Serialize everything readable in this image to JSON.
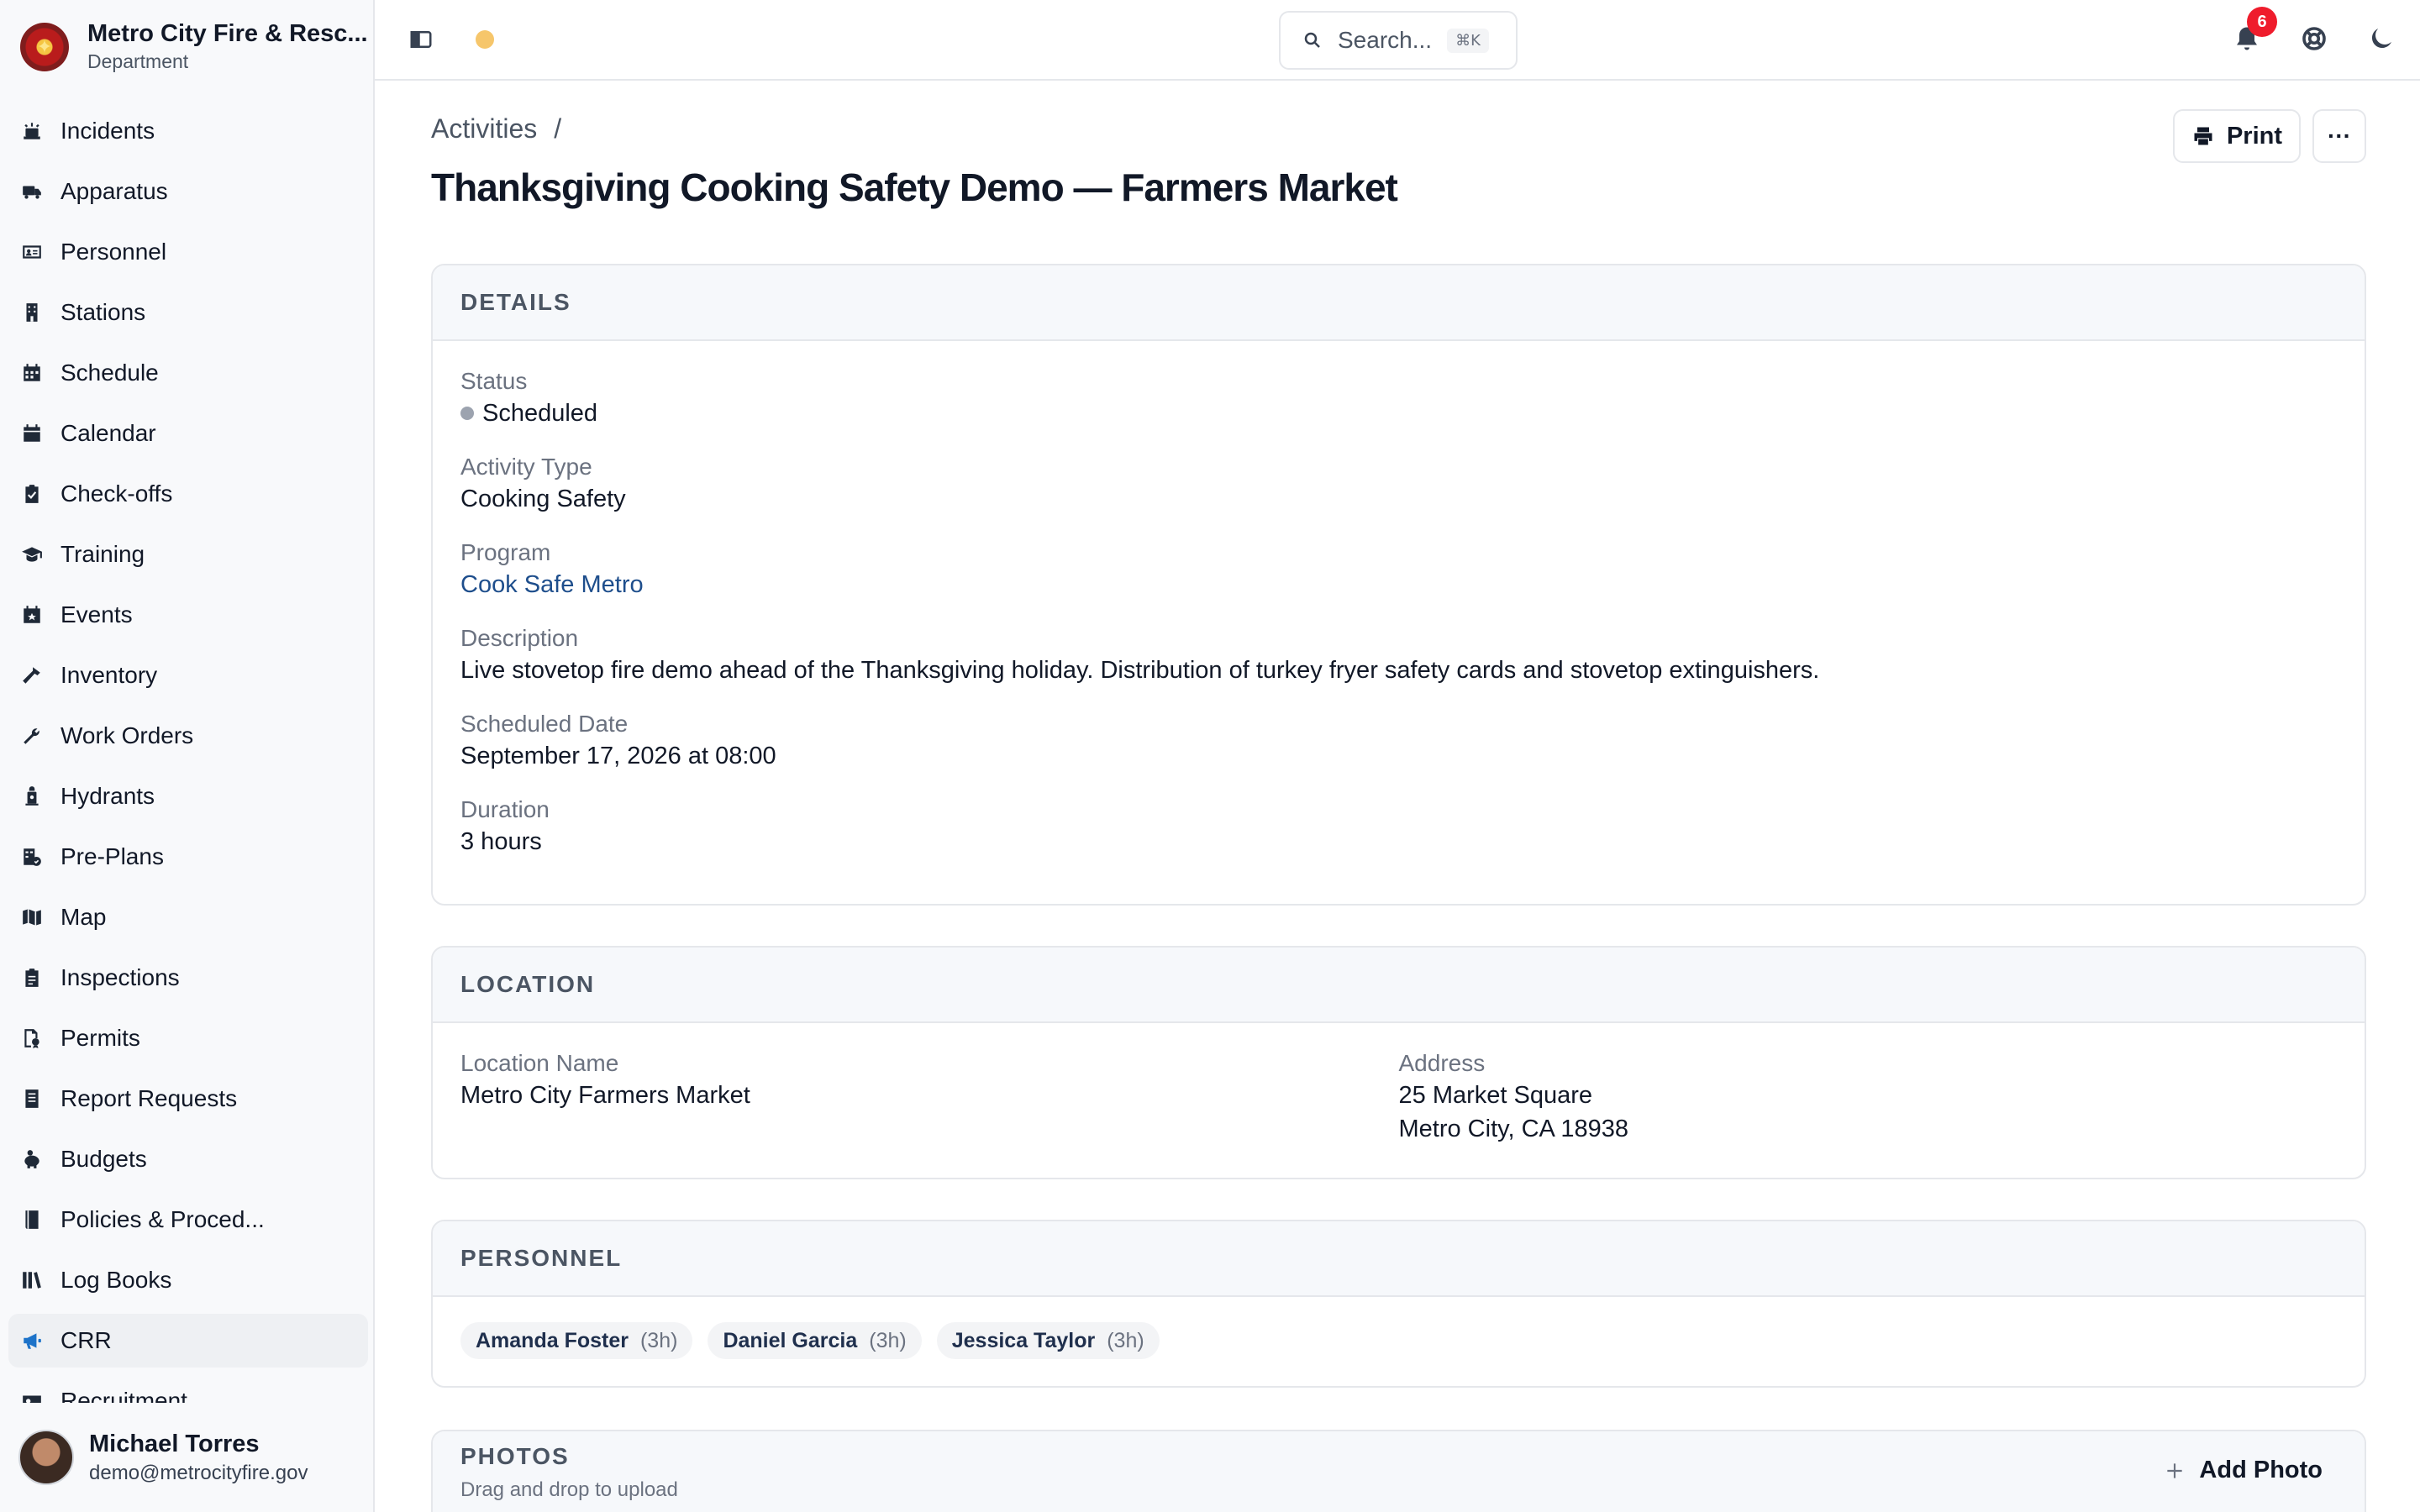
{
  "org": {
    "name": "Metro City Fire & Resc...",
    "subtitle": "Department"
  },
  "sidebar": {
    "items": [
      {
        "label": "Incidents",
        "icon": "incident-icon"
      },
      {
        "label": "Apparatus",
        "icon": "truck-icon"
      },
      {
        "label": "Personnel",
        "icon": "id-card-icon"
      },
      {
        "label": "Stations",
        "icon": "building-icon"
      },
      {
        "label": "Schedule",
        "icon": "calendar-grid-icon"
      },
      {
        "label": "Calendar",
        "icon": "calendar-icon"
      },
      {
        "label": "Check-offs",
        "icon": "clipboard-check-icon"
      },
      {
        "label": "Training",
        "icon": "graduation-cap-icon"
      },
      {
        "label": "Events",
        "icon": "calendar-star-icon"
      },
      {
        "label": "Inventory",
        "icon": "hammer-icon"
      },
      {
        "label": "Work Orders",
        "icon": "wrench-icon"
      },
      {
        "label": "Hydrants",
        "icon": "hydrant-icon"
      },
      {
        "label": "Pre-Plans",
        "icon": "plan-icon"
      },
      {
        "label": "Map",
        "icon": "map-icon"
      },
      {
        "label": "Inspections",
        "icon": "clipboard-icon"
      },
      {
        "label": "Permits",
        "icon": "permit-icon"
      },
      {
        "label": "Report Requests",
        "icon": "report-icon"
      },
      {
        "label": "Budgets",
        "icon": "piggy-bank-icon"
      },
      {
        "label": "Policies & Proced...",
        "icon": "book-icon"
      },
      {
        "label": "Log Books",
        "icon": "books-icon"
      },
      {
        "label": "CRR",
        "icon": "megaphone-icon",
        "active": true
      },
      {
        "label": "Recruitment",
        "icon": "recruit-icon"
      }
    ]
  },
  "user": {
    "name": "Michael Torres",
    "email": "demo@metrocityfire.gov"
  },
  "topbar": {
    "search_placeholder": "Search...",
    "search_shortcut": "⌘K",
    "notification_count": "6"
  },
  "breadcrumb": {
    "parent": "Activities",
    "separator": "/"
  },
  "page": {
    "title": "Thanksgiving Cooking Safety Demo — Farmers Market",
    "print_label": "Print",
    "more_label": "···"
  },
  "details": {
    "heading": "DETAILS",
    "status_label": "Status",
    "status_value": "Scheduled",
    "type_label": "Activity Type",
    "type_value": "Cooking Safety",
    "program_label": "Program",
    "program_value": "Cook Safe Metro",
    "description_label": "Description",
    "description_value": "Live stovetop fire demo ahead of the Thanksgiving holiday. Distribution of turkey fryer safety cards and stovetop extinguishers.",
    "date_label": "Scheduled Date",
    "date_value": "September 17, 2026 at 08:00",
    "duration_label": "Duration",
    "duration_value": "3 hours"
  },
  "location": {
    "heading": "LOCATION",
    "name_label": "Location Name",
    "name_value": "Metro City Farmers Market",
    "address_label": "Address",
    "address_line1": "25 Market Square",
    "address_line2": "Metro City, CA 18938"
  },
  "personnel": {
    "heading": "PERSONNEL",
    "people": [
      {
        "name": "Amanda Foster",
        "hours": "(3h)"
      },
      {
        "name": "Daniel Garcia",
        "hours": "(3h)"
      },
      {
        "name": "Jessica Taylor",
        "hours": "(3h)"
      }
    ]
  },
  "photos": {
    "heading": "PHOTOS",
    "subtitle": "Drag and drop to upload",
    "add_label": "Add Photo"
  },
  "colors": {
    "accent": "#1d73c9",
    "badge": "#ef1c2c",
    "link": "#1e4e8c"
  }
}
